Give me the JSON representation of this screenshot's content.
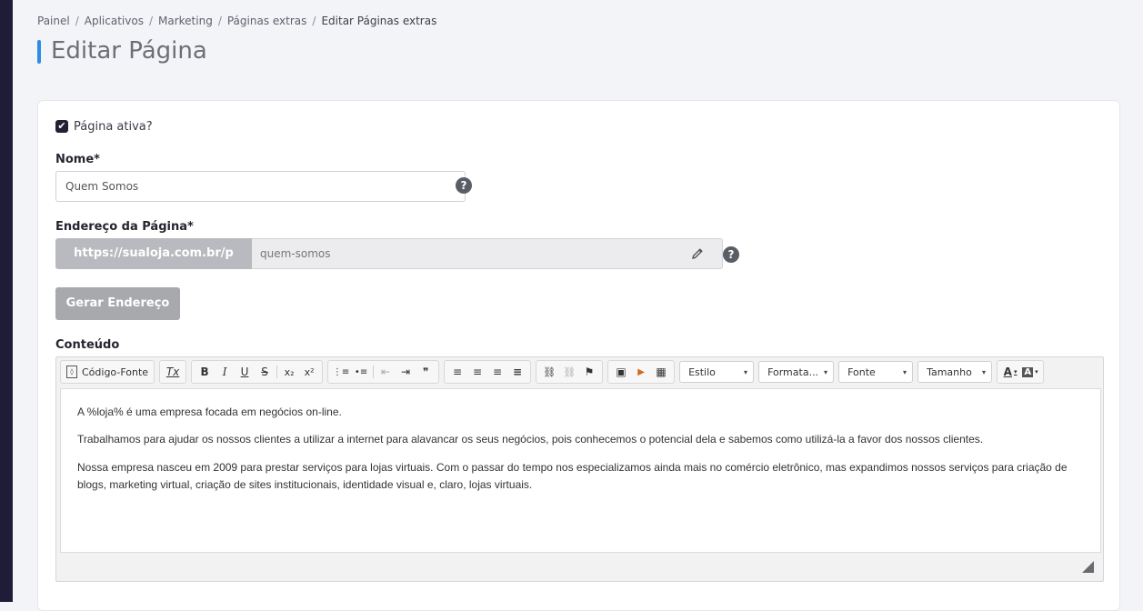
{
  "breadcrumb": {
    "items": [
      "Painel",
      "Aplicativos",
      "Marketing",
      "Páginas extras"
    ],
    "current": "Editar Páginas extras",
    "separator": "/"
  },
  "page": {
    "title": "Editar Página"
  },
  "form": {
    "active_checkbox": {
      "label": "Página ativa?",
      "checked": true,
      "check_glyph": "✔"
    },
    "name": {
      "label": "Nome*",
      "value": "Quem Somos"
    },
    "help_glyph": "?",
    "address": {
      "label": "Endereço da Página*",
      "prefix": "https://sualoja.com.br/p",
      "value": "quem-somos"
    },
    "generate_button": "Gerar Endereço",
    "content_label": "Conteúdo"
  },
  "editor": {
    "source_button": "Código-Fonte",
    "source_icon_glyph": "◊",
    "format_buttons": {
      "remove_format": "Tx",
      "bold": "B",
      "italic": "I",
      "underline": "U",
      "strike": "S",
      "subscript": "x₂",
      "superscript": "x²"
    },
    "list_buttons": {
      "numbered": "⋮≡",
      "bulleted": "•≡",
      "outdent": "⇤",
      "indent": "⇥",
      "blockquote": "❞"
    },
    "align_buttons": {
      "left": "≡",
      "center": "≡",
      "right": "≡",
      "justify": "≡"
    },
    "link_buttons": {
      "link": "⛓",
      "unlink": "⛓",
      "anchor": "⚑"
    },
    "insert_buttons": {
      "image": "▣",
      "video": "▶",
      "table": "▦"
    },
    "combos": [
      "Estilo",
      "Formata...",
      "Fonte",
      "Tamanho"
    ],
    "combo_arrow": "▾",
    "text_color_glyph": "A",
    "bg_color_glyph": "A",
    "paragraphs": [
      "A %loja% é uma empresa focada em negócios on-line.",
      "Trabalhamos para ajudar os nossos clientes a utilizar a internet para alavancar os seus negócios, pois conhecemos o potencial dela e sabemos como utilizá-la a favor dos nossos clientes.",
      "Nossa empresa nasceu em 2009 para prestar serviços para lojas virtuais. Com o passar do tempo nos especializamos ainda mais no comércio eletrônico, mas expandimos nossos serviços para criação de blogs, marketing virtual, criação de sites institucionais, identidade visual e, claro, lojas virtuais."
    ]
  },
  "colors": {
    "accent": "#2f8ce6",
    "sidebar": "#1f1c38",
    "checkbox": "#222133"
  }
}
